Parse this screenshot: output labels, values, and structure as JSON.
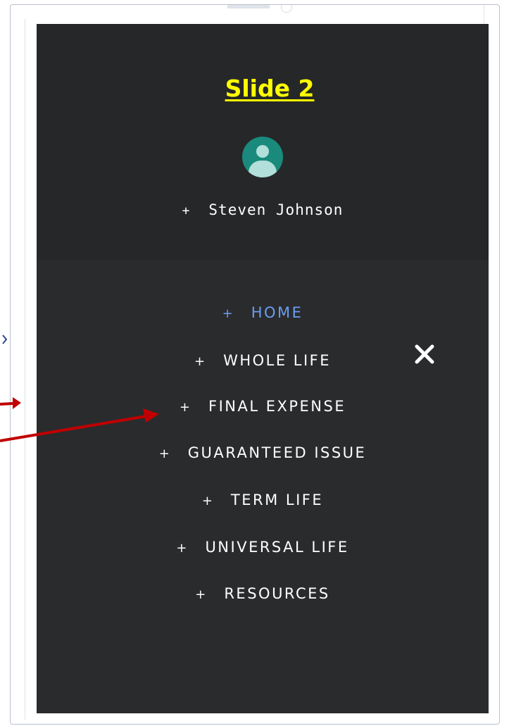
{
  "slide": {
    "title": "Slide 2",
    "title_color": "#ffff00"
  },
  "user": {
    "prefix": "+",
    "name": "Steven Johnson"
  },
  "menu": {
    "items": [
      {
        "prefix": "+",
        "label": "HOME",
        "active": true
      },
      {
        "prefix": "+",
        "label": "WHOLE LIFE",
        "active": false
      },
      {
        "prefix": "+",
        "label": "FINAL EXPENSE",
        "active": false
      },
      {
        "prefix": "+",
        "label": "GUARANTEED ISSUE",
        "active": false
      },
      {
        "prefix": "+",
        "label": "TERM LIFE",
        "active": false
      },
      {
        "prefix": "+",
        "label": "UNIVERSAL LIFE",
        "active": false
      },
      {
        "prefix": "+",
        "label": "RESOURCES",
        "active": false
      }
    ],
    "active_color": "#6b9df0",
    "text_color": "#ffffff",
    "panel_color": "#2a2b2d"
  },
  "controls": {
    "close_icon": "close-icon"
  },
  "avatar": {
    "icon": "user-avatar-icon",
    "color": "#1a8a7c"
  },
  "annotations": {
    "arrow_color": "#c00000",
    "arrow_icon": "red-arrow-icon"
  }
}
